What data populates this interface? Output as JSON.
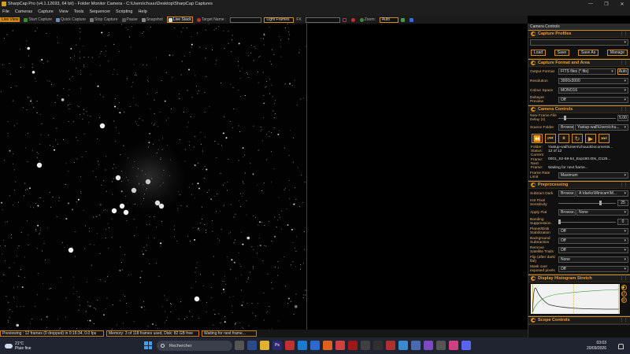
{
  "window": {
    "title": "SharpCap Pro (v4.1.12693, 64 bit) - Folder Monitor Camera - C:\\Users\\chuuu\\Desktop\\SharpCap Captures",
    "controls": [
      "—",
      "❐",
      "✕"
    ]
  },
  "menu": [
    "File",
    "Cameras",
    "Capture",
    "View",
    "Tools",
    "Sequencer",
    "Scripting",
    "Help"
  ],
  "toolbar": {
    "live_view": "Live View",
    "start_capture": "Start Capture",
    "quick_capture": "Quick Capture",
    "stop_capture": "Stop Capture",
    "pause": "Pause",
    "snapshot": "Snapshot",
    "live_stack": "Live Stack",
    "target_name_label": "Target Name :",
    "target_name_value": "",
    "frame_type": "Light Frames",
    "fx_label": "FX",
    "zoom_label": "Zoom:",
    "zoom_value": "Auto"
  },
  "status": {
    "preview": "Previewing : 12 frames (0 dropped) in 0:16:34, 0.0 fps",
    "memory": "Memory: 3 of 118 frames used, Disk: 82 GB free",
    "waiting": "Waiting for next frame..."
  },
  "panel": {
    "title": "Camera Controls",
    "capture_profiles": {
      "heading": "Capture Profiles",
      "buttons": [
        "Load",
        "Save",
        "Save As",
        "Manage"
      ]
    },
    "capture_format": {
      "heading": "Capture Format and Area",
      "rows": [
        {
          "label": "Output Format",
          "value": "FITS files (*.fits)",
          "extra": "Auto"
        },
        {
          "label": "Resolution",
          "value": "3000x3000"
        },
        {
          "label": "Colour Space",
          "value": "MONO16"
        },
        {
          "label": "Debayer Preview",
          "value": "Off"
        }
      ]
    },
    "camera_controls": {
      "heading": "Camera Controls",
      "new_frame_label": "New Frame File Delay (s)",
      "new_frame_value": "5.00",
      "source_folder_label": "Source Folder",
      "browse": "Browse...",
      "source_folder_value": "Yastup-wall\\Users\\chu...",
      "info": [
        {
          "k": "Folder:",
          "v": "Yastup-wall\\Users\\chuuu\\Documents..."
        },
        {
          "k": "Status:",
          "v": "12 of 12"
        },
        {
          "k": "Current Frame:",
          "v": "0001_S2-58-54_Exp180.00s_G125..."
        },
        {
          "k": "Next Frame:",
          "v": "Waiting for next frame..."
        }
      ],
      "frame_rate_label": "Frame Rate Limit",
      "frame_rate_value": "Maximum"
    },
    "preprocessing": {
      "heading": "Preprocessing",
      "subtract_dark_label": "Subtract Dark",
      "browse": "Browse...",
      "subtract_dark_value": "A:\\darks\\Minicam\\M...",
      "hot_pixel_label": "Hot Pixel Sensitivity",
      "hot_pixel_value": "25",
      "hot_pixel_level": 0.75,
      "apply_flat_label": "Apply Flat",
      "apply_flat_value": "None",
      "banding_label": "Banding Suppression",
      "banding_value": "0",
      "banding_level": 0.0,
      "rows": [
        {
          "label": "Planet/Disk Stabilization",
          "value": "Off"
        },
        {
          "label": "Background Subtraction",
          "value": "Off"
        },
        {
          "label": "Remove Satellite Trails",
          "value": "Off"
        },
        {
          "label": "Flip (after dark/ flat)",
          "value": "None"
        },
        {
          "label": "Mask over exposed pixels",
          "value": "Off"
        }
      ]
    },
    "histogram": {
      "heading": "Display Histogram Stretch"
    },
    "scope": {
      "heading": "Scope Controls"
    }
  },
  "taskbar": {
    "weather_temp": "21°C",
    "weather_desc": "Pluie fine",
    "search_placeholder": "Rechercher",
    "time": "03:03",
    "date": "20/09/2026"
  },
  "colors": {
    "accent": "#d48a19",
    "panel_bg": "#101010",
    "label": "#e8b070"
  }
}
